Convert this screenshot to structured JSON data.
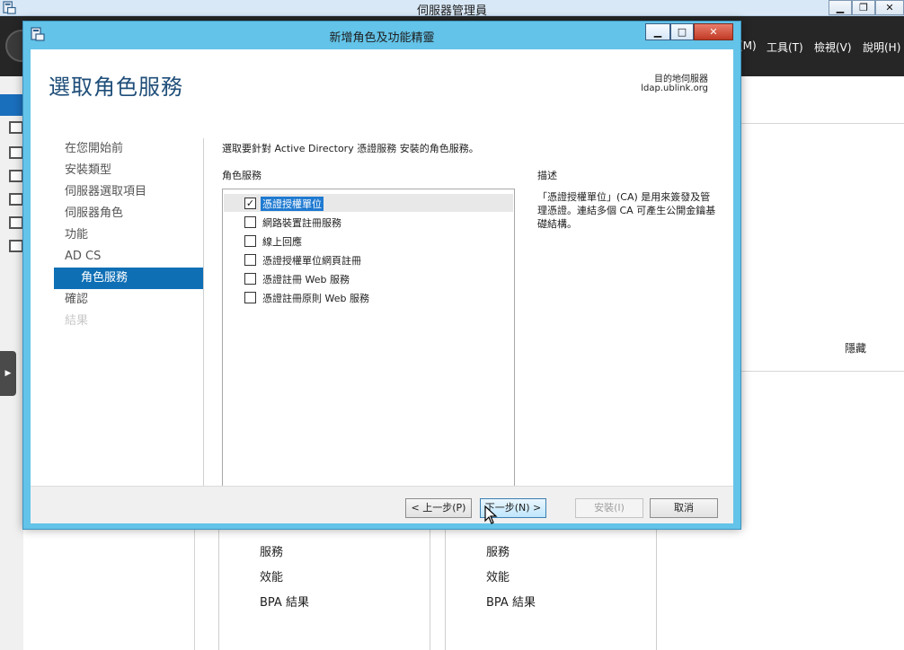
{
  "server_manager": {
    "title": "伺服器管理員",
    "window_controls": {
      "minimize": "▁",
      "restore": "❐",
      "close": "✕"
    },
    "menu": {
      "manage_partial": "(M)",
      "tools": "工具(T)",
      "view": "檢視(V)",
      "help": "說明(H)"
    },
    "panel_hide": "隱藏",
    "tiles": [
      {
        "items": [
          "服務",
          "效能",
          "BPA 結果"
        ]
      },
      {
        "items": [
          "服務",
          "效能",
          "BPA 結果"
        ]
      }
    ]
  },
  "wizard": {
    "title": "新增角色及功能精靈",
    "window_controls": {
      "minimize": "▁",
      "maximize": "□",
      "close": "✕"
    },
    "heading": "選取角色服務",
    "destination_label": "目的地伺服器",
    "destination_server": "ldap.ublink.org",
    "nav": [
      {
        "label": "在您開始前",
        "state": "normal"
      },
      {
        "label": "安裝類型",
        "state": "normal"
      },
      {
        "label": "伺服器選取項目",
        "state": "normal"
      },
      {
        "label": "伺服器角色",
        "state": "normal"
      },
      {
        "label": "功能",
        "state": "normal"
      },
      {
        "label": "AD CS",
        "state": "normal"
      },
      {
        "label": "角色服務",
        "state": "active"
      },
      {
        "label": "確認",
        "state": "normal"
      },
      {
        "label": "結果",
        "state": "disabled"
      }
    ],
    "instruction": "選取要針對 Active Directory 憑證服務 安裝的角色服務。",
    "role_services_header": "角色服務",
    "role_services": [
      {
        "label": "憑證授權單位",
        "checked": true,
        "selected": true
      },
      {
        "label": "網路裝置註冊服務",
        "checked": false,
        "selected": false
      },
      {
        "label": "線上回應",
        "checked": false,
        "selected": false
      },
      {
        "label": "憑證授權單位網頁註冊",
        "checked": false,
        "selected": false
      },
      {
        "label": "憑證註冊 Web 服務",
        "checked": false,
        "selected": false
      },
      {
        "label": "憑證註冊原則 Web 服務",
        "checked": false,
        "selected": false
      }
    ],
    "description_header": "描述",
    "description_text": "「憑證授權單位」(CA) 是用來簽發及管理憑證。連結多個 CA 可產生公開金鑰基礎結構。",
    "buttons": {
      "previous": "< 上一步(P)",
      "next": "下一步(N) >",
      "install": "安裝(I)",
      "cancel": "取消"
    }
  }
}
